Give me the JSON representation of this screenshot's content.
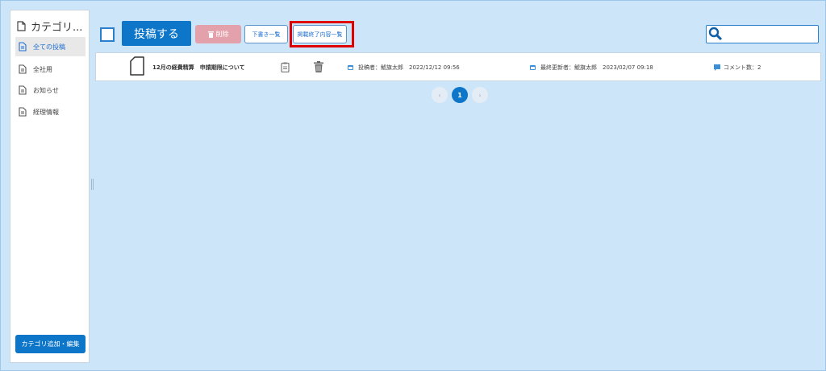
{
  "sidebar": {
    "title": "カテゴリ...",
    "items": [
      {
        "label": "全ての投稿"
      },
      {
        "label": "全社用"
      },
      {
        "label": "お知らせ"
      },
      {
        "label": "経理情報"
      }
    ],
    "add_button": "カテゴリ追加・編集"
  },
  "toolbar": {
    "post_label": "投稿する",
    "delete_label": "削除",
    "drafts_label": "下書き一覧",
    "expired_label": "掲載終了内容一覧",
    "search_placeholder": ""
  },
  "posts": [
    {
      "title": "12月の経費精算　申請期限について",
      "poster": "投稿者：鯱旗太郎　2022/12/12 09:56",
      "updater": "最終更新者：鯱旗太郎　2023/02/07 09:18",
      "comments": "コメント数：2"
    }
  ],
  "pagination": {
    "prev": "‹",
    "current": "1",
    "next": "›"
  },
  "colors": {
    "accent": "#0d76c9",
    "background": "#cde5f8",
    "delete": "#e3a2ab",
    "highlight": "#e00000"
  }
}
